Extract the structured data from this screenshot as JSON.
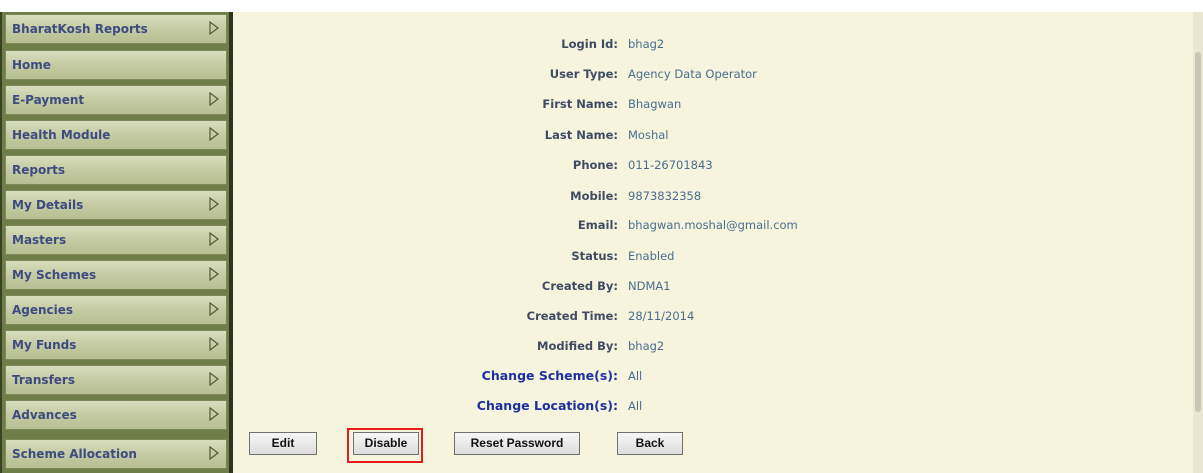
{
  "sidebar": {
    "items": [
      {
        "label": "BharatKosh Reports",
        "has_submenu": true
      },
      {
        "label": "Home",
        "has_submenu": false
      },
      {
        "label": "E-Payment",
        "has_submenu": true
      },
      {
        "label": "Health Module",
        "has_submenu": true
      },
      {
        "label": "Reports",
        "has_submenu": false
      },
      {
        "label": "My Details",
        "has_submenu": true
      },
      {
        "label": "Masters",
        "has_submenu": true
      },
      {
        "label": "My Schemes",
        "has_submenu": true
      },
      {
        "label": "Agencies",
        "has_submenu": true
      },
      {
        "label": "My Funds",
        "has_submenu": true
      },
      {
        "label": "Transfers",
        "has_submenu": true
      },
      {
        "label": "Advances",
        "has_submenu": true
      },
      {
        "label": "Scheme Allocation",
        "has_submenu": true
      }
    ],
    "arrow_icon": "triangle-right-outline-icon"
  },
  "details": {
    "rows": [
      {
        "label": "Login Id:",
        "value": "bhag2"
      },
      {
        "label": "User Type:",
        "value": "Agency Data Operator"
      },
      {
        "label": "First Name:",
        "value": "Bhagwan"
      },
      {
        "label": "Last Name:",
        "value": "Moshal"
      },
      {
        "label": "Phone:",
        "value": "011-26701843"
      },
      {
        "label": "Mobile:",
        "value": "9873832358"
      },
      {
        "label": "Email:",
        "value": "bhagwan.moshal@gmail.com"
      },
      {
        "label": "Status:",
        "value": "Enabled"
      },
      {
        "label": "Created By:",
        "value": "NDMA1"
      },
      {
        "label": "Created Time:",
        "value": "28/11/2014"
      },
      {
        "label": "Modified By:",
        "value": "bhag2"
      }
    ],
    "links": [
      {
        "label": "Change Scheme(s):",
        "value": "All"
      },
      {
        "label": "Change Location(s):",
        "value": "All"
      }
    ]
  },
  "buttons": {
    "edit": "Edit",
    "disable": "Disable",
    "reset_password": "Reset Password",
    "back": "Back"
  },
  "colors": {
    "sidebar_bg": "#6f7d49",
    "menu_item": "#c8cea6",
    "menu_text": "#3d4b80",
    "content_bg": "#f6f4dd",
    "label_text": "#3f4b63",
    "value_text": "#4a6d8f",
    "link_text": "#1e2fa0",
    "highlight": "#e81b1b"
  }
}
